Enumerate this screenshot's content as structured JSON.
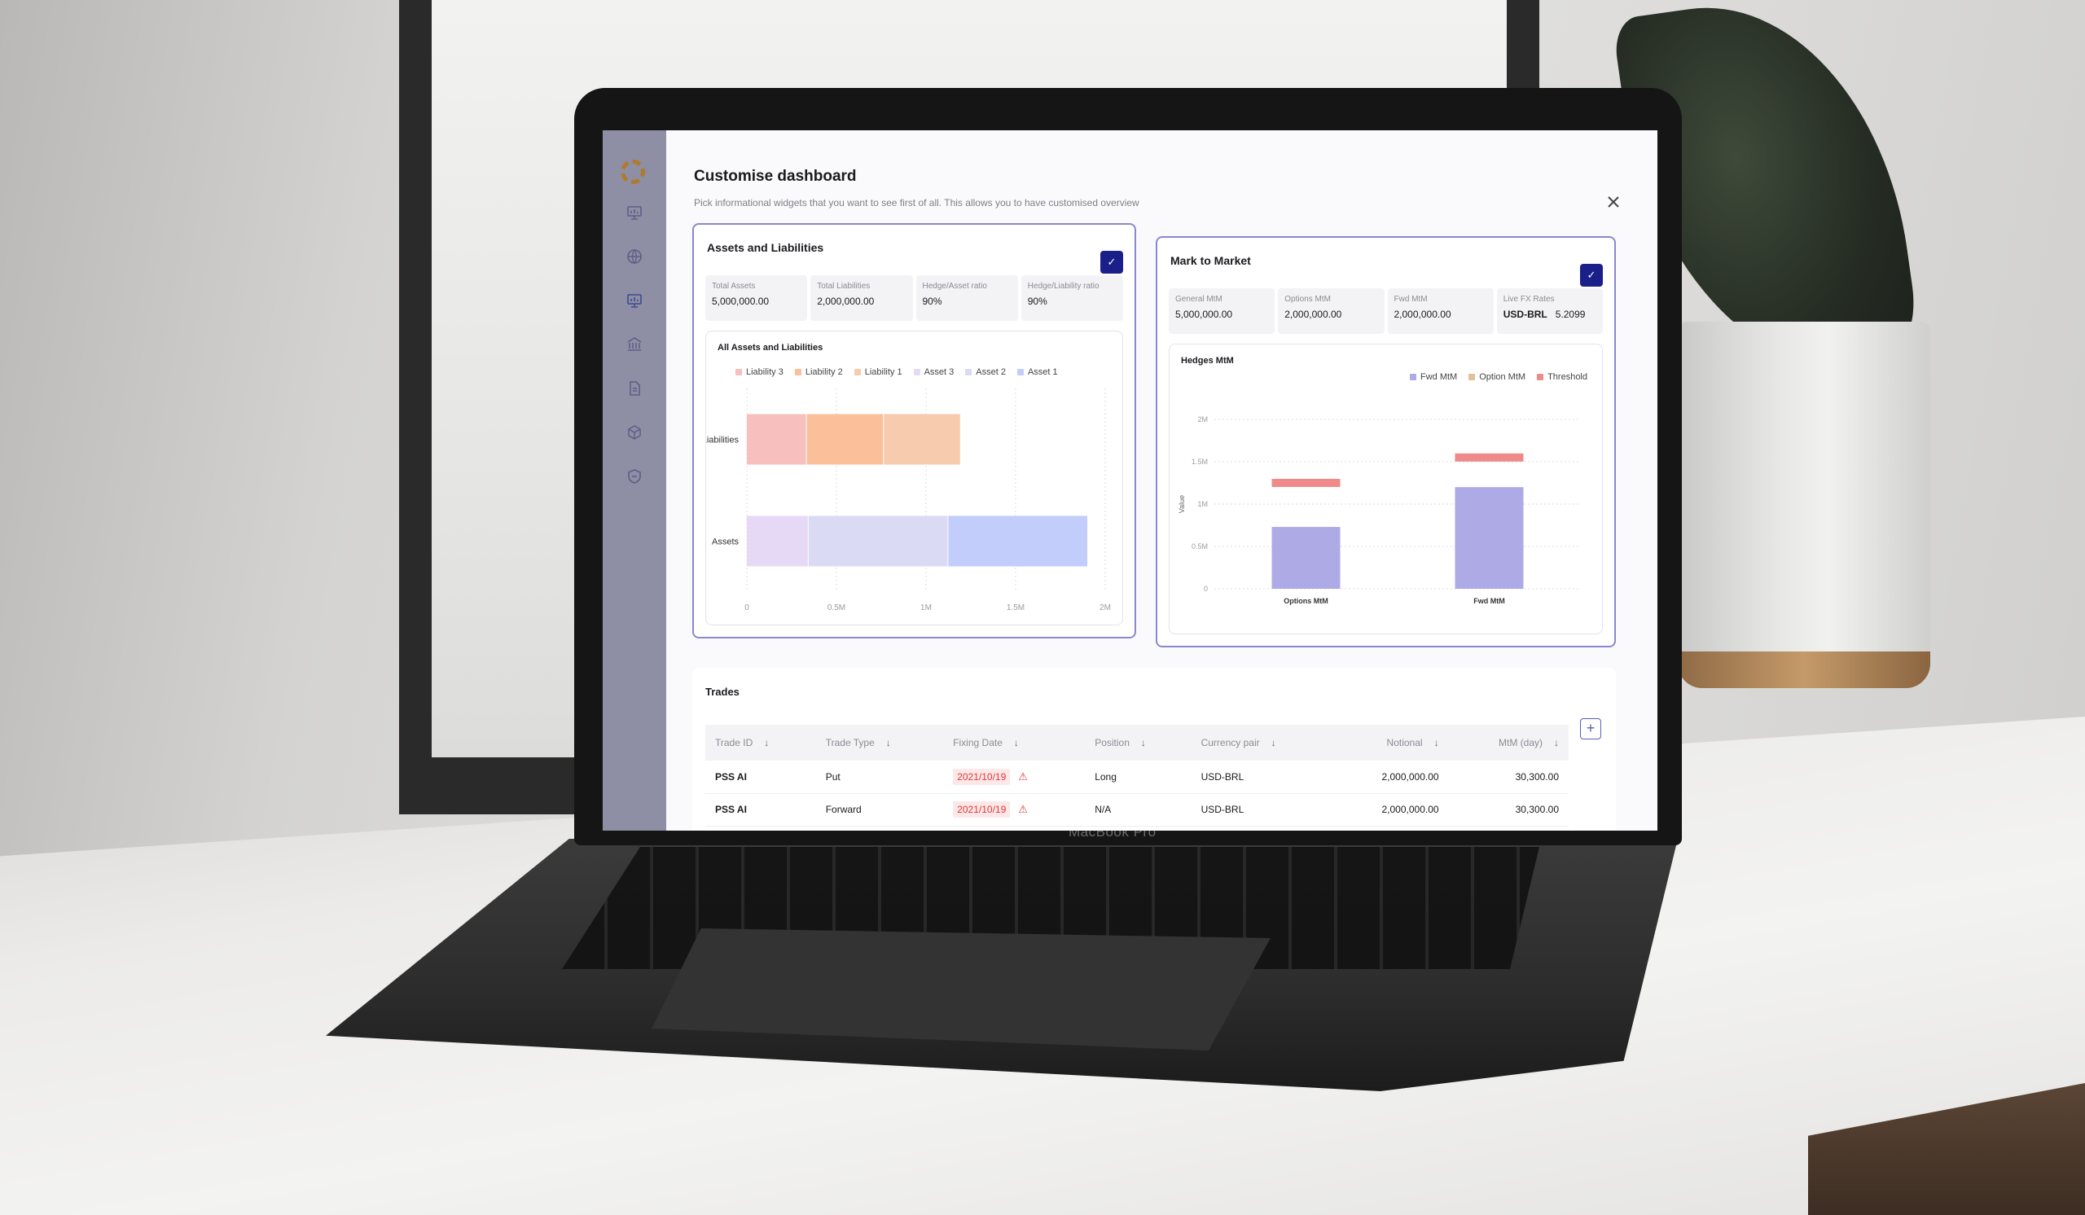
{
  "device": {
    "brand_label": "MacBook Pro"
  },
  "sidebar": {
    "logo": "g-logo-icon",
    "items": [
      {
        "icon": "presentation-chart-icon",
        "active": false
      },
      {
        "icon": "globe-icon",
        "active": false
      },
      {
        "icon": "presentation-chart-icon",
        "active": true
      },
      {
        "icon": "bank-icon",
        "active": false
      },
      {
        "icon": "document-icon",
        "active": false
      },
      {
        "icon": "cube-icon",
        "active": false
      },
      {
        "icon": "shield-icon",
        "active": false
      }
    ]
  },
  "modal": {
    "title": "Customise dashboard",
    "subtitle": "Pick informational widgets that you want to see first of all. This allows you to have customised overview",
    "close_icon": "close-icon"
  },
  "widgets": {
    "assets_liabilities": {
      "title": "Assets and Liabilities",
      "checked": true,
      "check_glyph": "✓",
      "stats": [
        {
          "label": "Total Assets",
          "value": "5,000,000.00"
        },
        {
          "label": "Total Liabilities",
          "value": "2,000,000.00"
        },
        {
          "label": "Hedge/Asset ratio",
          "value": "90%"
        },
        {
          "label": "Hedge/Liability ratio",
          "value": "90%"
        }
      ]
    },
    "mark_to_market": {
      "title": "Mark to Market",
      "checked": true,
      "check_glyph": "✓",
      "stats": [
        {
          "label": "General MtM",
          "value": "5,000,000.00"
        },
        {
          "label": "Options MtM",
          "value": "2,000,000.00"
        },
        {
          "label": "Fwd MtM",
          "value": "2,000,000.00"
        },
        {
          "label": "Live FX Rates",
          "pair": "USD-BRL",
          "value": "5.2099"
        }
      ]
    }
  },
  "chart_data": [
    {
      "type": "bar",
      "orientation": "horizontal",
      "stacked": true,
      "title": "All Assets and Liabilities",
      "categories": [
        "Liabilities",
        "Assets"
      ],
      "series": [
        {
          "name": "Liability 3",
          "color": "#f7bfbd",
          "values": [
            330000,
            0
          ]
        },
        {
          "name": "Liability 2",
          "color": "#fbbf9a",
          "values": [
            430000,
            0
          ]
        },
        {
          "name": "Liability 1",
          "color": "#f7cbad",
          "values": [
            430000,
            0
          ]
        },
        {
          "name": "Asset 3",
          "color": "#e6d9f6",
          "values": [
            0,
            340000
          ]
        },
        {
          "name": "Asset 2",
          "color": "#dadaf4",
          "values": [
            0,
            780000
          ]
        },
        {
          "name": "Asset 1",
          "color": "#c2cdfb",
          "values": [
            0,
            780000
          ]
        }
      ],
      "xlim": [
        0,
        2000000
      ],
      "xticks": [
        "0",
        "0.5M",
        "1M",
        "1.5M",
        "2M"
      ],
      "legend": "top",
      "grid": true,
      "xlabel": "",
      "ylabel": ""
    },
    {
      "type": "bar",
      "title": "Hedges MtM",
      "categories": [
        "Options MtM",
        "Fwd MtM"
      ],
      "series": [
        {
          "name": "Fwd MtM",
          "color": "#adaae6",
          "values": [
            730000,
            1200000
          ]
        },
        {
          "name": "Option MtM",
          "color": "#dfc29a",
          "values": []
        },
        {
          "name": "Threshold",
          "color": "#ef8a8a",
          "values": [
            1250000,
            1550000
          ]
        }
      ],
      "ylim": [
        0,
        2000000
      ],
      "yticks": [
        "0",
        "0.5M",
        "1M",
        "1.5M",
        "2M"
      ],
      "ylabel": "Value",
      "xlabel": "",
      "legend": "top-right",
      "grid": true
    }
  ],
  "trades": {
    "title": "Trades",
    "add_label": "+",
    "columns": [
      {
        "label": "Trade ID",
        "sort": "↓"
      },
      {
        "label": "Trade Type",
        "sort": "↓"
      },
      {
        "label": "Fixing Date",
        "sort": "↓"
      },
      {
        "label": "Position",
        "sort": "↓"
      },
      {
        "label": "Currency pair",
        "sort": "↓"
      },
      {
        "label": "Notional",
        "sort": "↓"
      },
      {
        "label": "MtM (day)",
        "sort": "↓"
      }
    ],
    "rows": [
      {
        "id": "PSS AI",
        "type": "Put",
        "fixing_date": "2021/10/19",
        "warning": true,
        "position": "Long",
        "pair": "USD-BRL",
        "notional": "2,000,000.00",
        "mtm": "30,300.00"
      },
      {
        "id": "PSS AI",
        "type": "Forward",
        "fixing_date": "2021/10/19",
        "warning": true,
        "position": "N/A",
        "pair": "USD-BRL",
        "notional": "2,000,000.00",
        "mtm": "30,300.00"
      }
    ]
  }
}
